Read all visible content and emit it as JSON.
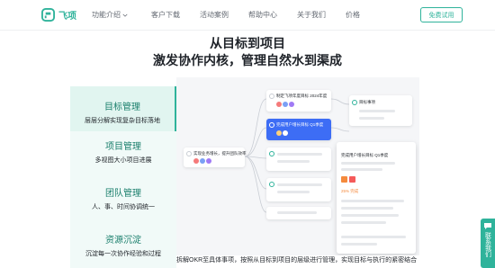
{
  "brand": {
    "name": "飞项",
    "color": "#2fb39b"
  },
  "nav": {
    "items": [
      {
        "label": "功能介绍",
        "has_dropdown": true
      },
      {
        "label": "客户下载",
        "has_dropdown": false
      },
      {
        "label": "活动案例",
        "has_dropdown": false
      },
      {
        "label": "帮助中心",
        "has_dropdown": false
      },
      {
        "label": "关于我们",
        "has_dropdown": false
      },
      {
        "label": "价格",
        "has_dropdown": false
      }
    ],
    "cta_label": "免费试用"
  },
  "hero": {
    "headline": "从目标到项目",
    "subheadline": "激发协作内核，管理自然水到渠成"
  },
  "features": [
    {
      "title": "目标管理",
      "desc": "层层分解实现复杂目标落地",
      "active": true
    },
    {
      "title": "项目管理",
      "desc": "多视图大小项目进展",
      "active": false
    },
    {
      "title": "团队管理",
      "desc": "人、事、时间协调统一",
      "active": false
    },
    {
      "title": "资源沉淀",
      "desc": "沉淀每一次协作经验和过程",
      "active": false
    }
  ],
  "illustration": {
    "root_card": "实现业务增长，提升团队效率",
    "top_card": "制定飞项年度目标 2024年度",
    "selected_card": "完成用户增长目标 Q1季度",
    "right_card": "目标事项",
    "detail_title": "完成用户增长目标 Q1季度",
    "detail_progress": "25% 完成"
  },
  "bottom_note": "拆解OKR至具体事项，按照从目标到项目的层级进行管理，实现目标与执行的紧密结合",
  "float_tab": {
    "label": "联系我们"
  }
}
